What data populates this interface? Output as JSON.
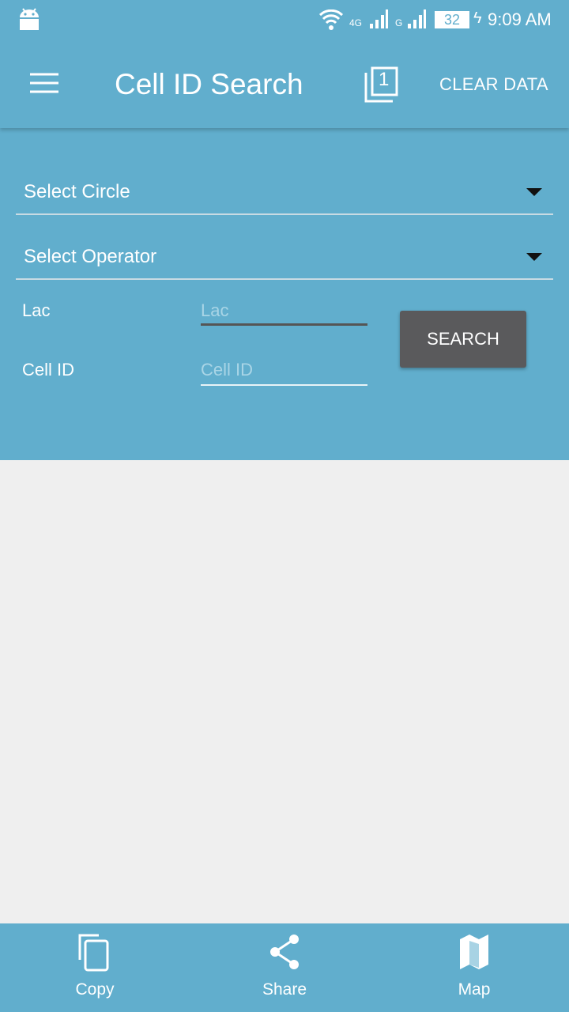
{
  "status_bar": {
    "time": "9:09 AM",
    "battery": "32",
    "network_1": "4G",
    "network_2": "G"
  },
  "app_bar": {
    "title": "Cell ID Search",
    "clear_label": "CLEAR DATA",
    "badge_count": "1"
  },
  "form": {
    "circle_select": "Select Circle",
    "operator_select": "Select Operator",
    "lac_label": "Lac",
    "lac_placeholder": "Lac",
    "lac_value": "",
    "cellid_label": "Cell ID",
    "cellid_placeholder": "Cell ID",
    "cellid_value": "",
    "search_label": "SEARCH"
  },
  "bottom_nav": [
    {
      "label": "Copy",
      "icon": "copy-icon"
    },
    {
      "label": "Share",
      "icon": "share-icon"
    },
    {
      "label": "Map",
      "icon": "map-icon"
    }
  ],
  "colors": {
    "primary": "#61aecd",
    "button": "#5a5a5c",
    "background": "#efefef"
  }
}
